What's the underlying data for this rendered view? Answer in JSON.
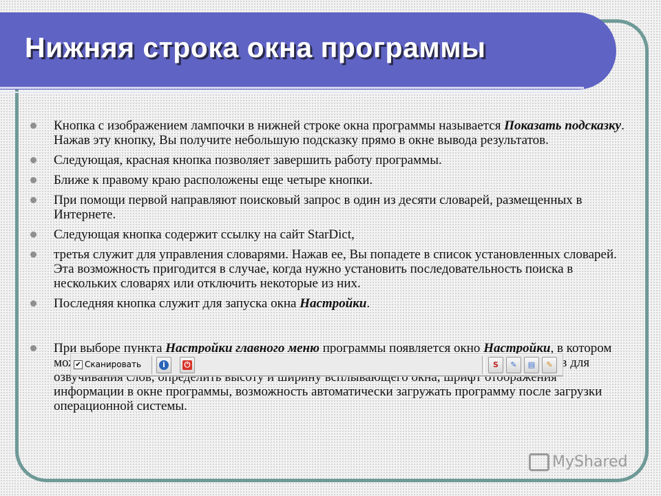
{
  "slide": {
    "title": "Нижняя строка окна программы",
    "bullets": [
      {
        "before": "Кнопка с изображением лампочки в нижней строке окна программы называется ",
        "em": "Показать подсказку",
        "after": ". Нажав эту кнопку, Вы получите небольшую подсказку прямо в окне вывода результатов."
      },
      {
        "text": "Следующая, красная кнопка позволяет завершить работу программы."
      },
      {
        "text": "Ближе к правому краю расположены еще четыре кнопки."
      },
      {
        "text": "При помощи первой направляют поисковый запрос в один из десяти словарей, размещенных в Интернете."
      },
      {
        "text": "Следующая кнопка содержит ссылку на сайт StarDict,"
      },
      {
        "text": "третья служит для управления словарями. Нажав ее, Вы попадете в список установленных словарей. Эта возможность пригодится в случае, когда нужно установить последовательность поиска в нескольких словарях или отключить некоторые из них."
      },
      {
        "before": "Последняя кнопка служит для запуска окна ",
        "em": "Настройки",
        "after": "."
      },
      {
        "before": "При выборе пункта ",
        "em": "Настройки главного меню",
        "after": " программы появляется окно ",
        "em2": "Настройки",
        "after2": ", в котором можно задать использование кэша для увеличения скорости загрузки, использование звуков для озвучивания слов, определить высоту и ширину всплывающего окна, шрифт отображения информации в окне программы, возможность автоматически загружать программу после загрузки операционной системы."
      }
    ]
  },
  "status_bar": {
    "checkbox_label": "Сканировать",
    "checkbox_checked": true,
    "check_mark": "✔",
    "left_buttons": [
      {
        "icon": "info-icon",
        "glyph": "i",
        "color": "#2a63b8"
      },
      {
        "icon": "power-icon",
        "glyph": "⏻",
        "color": "#d8322a"
      }
    ],
    "right_buttons": [
      {
        "icon": "web-search-icon",
        "glyph": "S",
        "color": "#c02020"
      },
      {
        "icon": "dictionary-link-icon",
        "glyph": "✎",
        "color": "#3a6fd0"
      },
      {
        "icon": "dictionaries-manager-icon",
        "glyph": "▤",
        "color": "#3a6fd0"
      },
      {
        "icon": "preferences-icon",
        "glyph": "✎",
        "color": "#d08a20"
      }
    ]
  },
  "watermark": {
    "text": "MyShared"
  }
}
